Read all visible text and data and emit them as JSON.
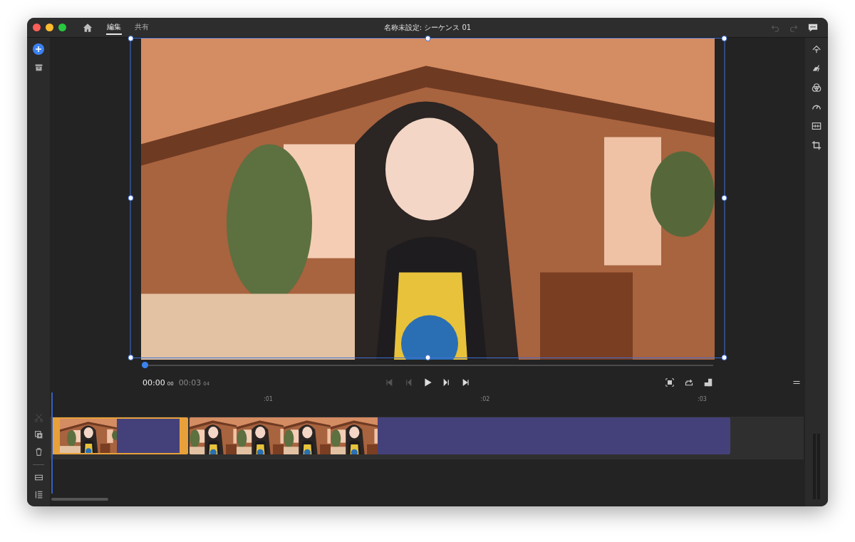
{
  "window": {
    "title": "名称未設定: シーケンス 01"
  },
  "tabs": [
    {
      "label": "編集",
      "selected": true
    },
    {
      "label": "共有",
      "selected": false
    }
  ],
  "history": [
    {
      "kind": "undo",
      "disabled": true
    },
    {
      "kind": "redo",
      "disabled": true
    }
  ],
  "player": {
    "scrub": {
      "level": 0
    },
    "current_time": "00:00",
    "current_frames": "00",
    "duration": "00:03",
    "duration_frames": "04"
  },
  "transport": [
    {
      "kind": "start",
      "disabled": true
    },
    {
      "kind": "prev",
      "disabled": true
    },
    {
      "kind": "play",
      "disabled": false
    },
    {
      "kind": "next",
      "disabled": false
    },
    {
      "kind": "end",
      "disabled": false
    }
  ],
  "ruler": [
    ":01",
    ":02",
    ":03"
  ],
  "timeline_tools": [
    {
      "kind": "split",
      "disabled": true
    },
    {
      "kind": "duplicate",
      "disabled": false
    },
    {
      "kind": "delete",
      "disabled": false
    }
  ],
  "clips": [
    {
      "selected": true
    },
    {
      "selected": false
    }
  ]
}
